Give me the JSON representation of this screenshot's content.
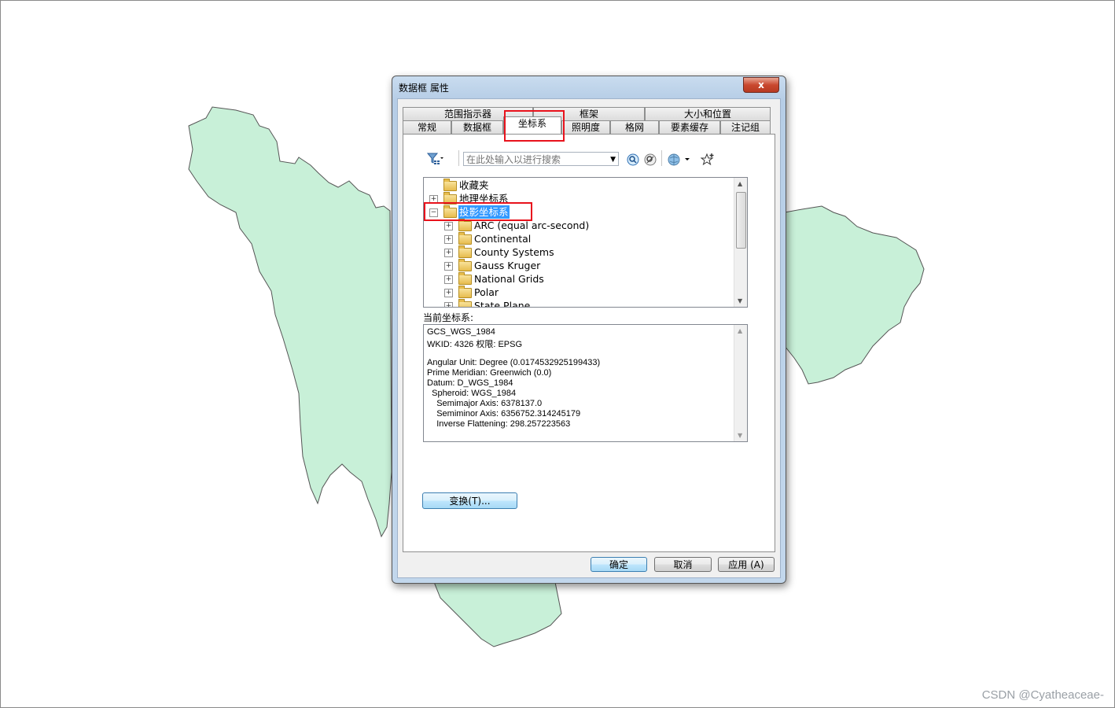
{
  "dialog": {
    "title": "数据框 属性",
    "close_glyph": "x",
    "tabs_row1": [
      "范围指示器",
      "框架",
      "大小和位置"
    ],
    "tabs_row2": [
      "常规",
      "数据框",
      "坐标系",
      "照明度",
      "格网",
      "要素缓存",
      "注记组"
    ],
    "active_tab": "坐标系"
  },
  "toolbar": {
    "filter_icon": "filter-icon",
    "search_placeholder": "在此处输入以进行搜索",
    "icons": [
      "search-icon",
      "clear-search-icon",
      "globe-icon",
      "add-favorite-icon"
    ]
  },
  "tree": {
    "items": [
      {
        "label": "收藏夹",
        "level": 0,
        "expander": ""
      },
      {
        "label": "地理坐标系",
        "level": 0,
        "expander": "+"
      },
      {
        "label": "投影坐标系",
        "level": 0,
        "expander": "−",
        "selected": true
      },
      {
        "label": "ARC (equal arc-second)",
        "level": 1,
        "expander": "+"
      },
      {
        "label": "Continental",
        "level": 1,
        "expander": "+"
      },
      {
        "label": "County Systems",
        "level": 1,
        "expander": "+"
      },
      {
        "label": "Gauss Kruger",
        "level": 1,
        "expander": "+"
      },
      {
        "label": "National Grids",
        "level": 1,
        "expander": "+"
      },
      {
        "label": "Polar",
        "level": 1,
        "expander": "+"
      },
      {
        "label": "State Plane",
        "level": 1,
        "expander": "+"
      }
    ]
  },
  "current": {
    "label": "当前坐标系:",
    "lines": [
      "GCS_WGS_1984",
      "WKID: 4326 权限: EPSG",
      "",
      "Angular Unit: Degree (0.0174532925199433)",
      "Prime Meridian: Greenwich (0.0)",
      "Datum: D_WGS_1984",
      "  Spheroid: WGS_1984",
      "    Semimajor Axis: 6378137.0",
      "    Semiminor Axis: 6356752.314245179",
      "    Inverse Flattening: 298.257223563"
    ]
  },
  "buttons": {
    "transform": "变换(T)...",
    "ok": "确定",
    "cancel": "取消",
    "apply": "应用 (A)"
  },
  "watermark": "CSDN @Cyatheaceae-",
  "colors": {
    "map_fill": "#c8f0d8",
    "map_stroke": "#555555",
    "highlight": "#e8121c",
    "selection": "#3399ff"
  }
}
